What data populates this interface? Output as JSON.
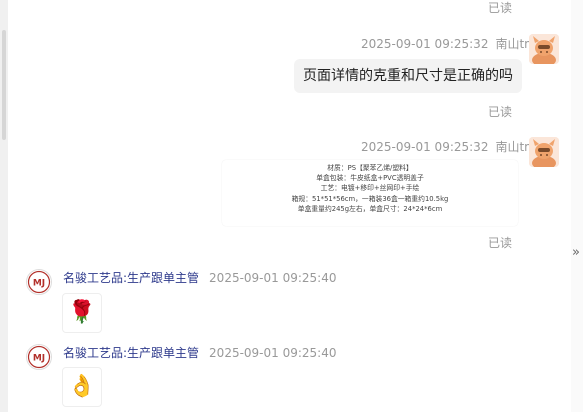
{
  "messages": {
    "read_top": "已读",
    "msg1": {
      "timestamp": "2025-09-01 09:25:32",
      "sender": "南山tm",
      "text": "页面详情的克重和尺寸是正确的吗",
      "read": "已读"
    },
    "msg2": {
      "timestamp": "2025-09-01 09:25:32",
      "sender": "南山tm",
      "spec_lines": [
        "材质：PS【聚苯乙烯/塑料】",
        "单盒包装：牛皮纸盒+PVC透明盖子",
        "工艺：电镀+移印+丝网印+手绘",
        "箱规：51*51*56cm，一箱装36盒一箱重约10.5kg",
        "单盒重量约245g左右，单盒尺寸：24*24*6cm"
      ],
      "read": "已读"
    },
    "msg3": {
      "sender": "名骏工艺品:生产跟单主管",
      "timestamp": "2025-09-01 09:25:40",
      "content": "🌹"
    },
    "msg4": {
      "sender": "名骏工艺品:生产跟单主管",
      "timestamp": "2025-09-01 09:25:40",
      "content": "👌"
    }
  },
  "ui": {
    "mj_avatar_text": "MJ",
    "collapse_icon": "»",
    "colors": {
      "sender_name": "#2e3a8c",
      "meta": "#999999",
      "bubble": "#f3f3f3",
      "mj_red": "#b2302a",
      "cat_orange": "#e8955f"
    }
  }
}
